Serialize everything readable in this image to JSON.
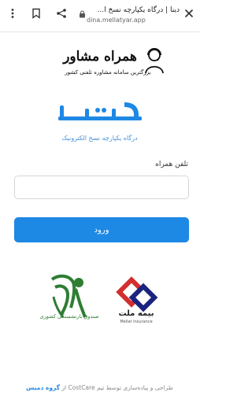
{
  "browser": {
    "title": "دینا | درگاه یکپارچه نسخ ا...",
    "url": "dina.mellatyar.app",
    "icons": {
      "close": "close-icon",
      "share": "share-icon",
      "bookmark": "bookmark-icon",
      "menu": "more-vert-icon",
      "lock": "lock-icon"
    }
  },
  "watermark": {
    "title": "همراه مشاور",
    "subtitle": "بزرگترین سامانه مشاوره تلفنی کشور"
  },
  "brand": {
    "logo_text": "دینا",
    "tagline": "درگاه یکپارچه نسخ الکترونیک"
  },
  "form": {
    "phone_label": "تلفن همراه",
    "phone_value": "",
    "login_label": "ورود"
  },
  "partners": {
    "left_caption": "صندوق بازنشستگی کشوری",
    "right_fa": "بیمه ملت",
    "right_en": "Mellat Insurance"
  },
  "footer": {
    "text": "طراحی و پیاده‌سازی توسط تیم CostCare از",
    "link": "گروه دمیس"
  },
  "colors": {
    "accent": "#1e88e5",
    "logo": "#1e88e5",
    "partner_green": "#2e7d32",
    "partner_red": "#d32f2f",
    "partner_blue": "#1a237e"
  }
}
